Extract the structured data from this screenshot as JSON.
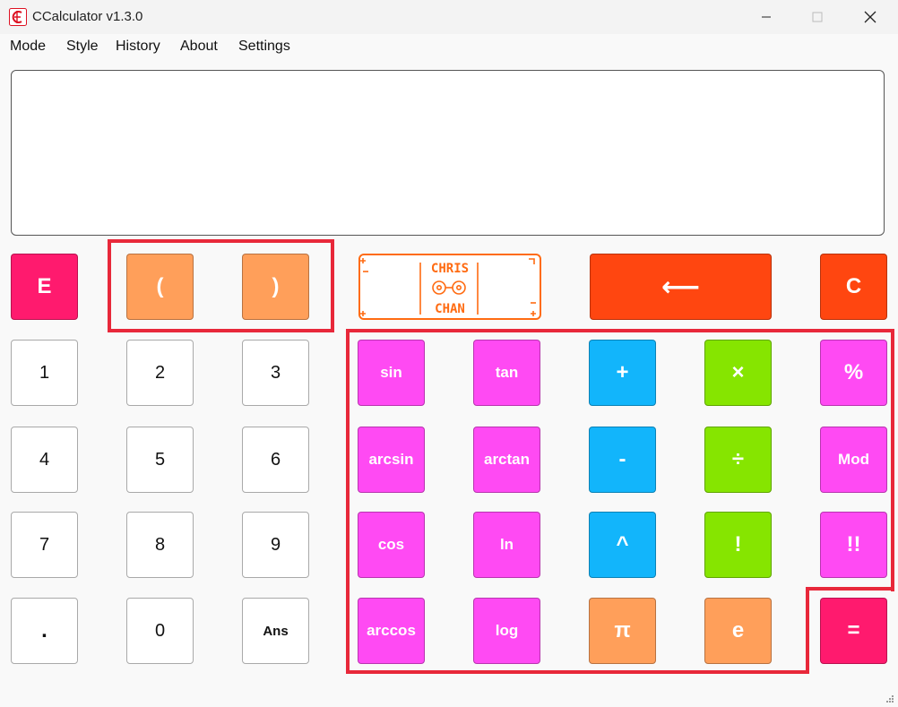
{
  "window": {
    "title": "CCalculator v1.3.0"
  },
  "menu": [
    "Mode",
    "Style",
    "History",
    "About",
    "Settings"
  ],
  "display": {
    "value": ""
  },
  "logo": {
    "lines": [
      "CHRIS",
      "CHAN"
    ]
  },
  "colors": {
    "function_pink": "#ff4af3",
    "operator_blue": "#12b5fb",
    "operator_green": "#86e500",
    "constant_orange": "#ff9f5a",
    "backspace_red": "#ff4610",
    "accent_rose": "#ff1a6e",
    "highlight_red": "#e8283a"
  },
  "buttons": {
    "e_exp": "E",
    "paren_open": "(",
    "paren_close": ")",
    "backspace": "⟵",
    "clear": "C",
    "one": "1",
    "two": "2",
    "three": "3",
    "four": "4",
    "five": "5",
    "six": "6",
    "seven": "7",
    "eight": "8",
    "nine": "9",
    "dot": ".",
    "zero": "0",
    "ans": "Ans",
    "sin": "sin",
    "tan": "tan",
    "plus": "+",
    "multiply": "×",
    "percent": "%",
    "arcsin": "arcsin",
    "arctan": "arctan",
    "minus": "-",
    "divide": "÷",
    "mod": "Mod",
    "cos": "cos",
    "ln": "ln",
    "power": "^",
    "factorial": "!",
    "double_factorial": "!!",
    "arccos": "arccos",
    "log": "log",
    "pi": "π",
    "euler": "e",
    "equals": "="
  }
}
